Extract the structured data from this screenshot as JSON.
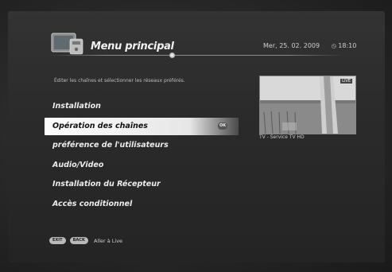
{
  "header": {
    "title": "Menu principal",
    "date": "Mer, 25. 02. 2009",
    "time": "18:10"
  },
  "description": "Éditer les chaînes et sélectionner les réseaux préférés.",
  "menu": {
    "items": [
      {
        "label": "Installation",
        "selected": false
      },
      {
        "label": "Opération des chaînes",
        "selected": true
      },
      {
        "label": "préférence de l'utilisateurs",
        "selected": false
      },
      {
        "label": "Audio/Video",
        "selected": false
      },
      {
        "label": "Installation du Récepteur",
        "selected": false
      },
      {
        "label": "Accès conditionnel",
        "selected": false
      }
    ],
    "ok_label": "OK"
  },
  "preview": {
    "badge": "LIVE",
    "channel_label": "TV - Service TV HD"
  },
  "footer": {
    "exit_label": "EXIT",
    "back_label": "BACK",
    "hint": "Aller à Live"
  },
  "icons": {
    "logo": "tv-menu-logo-icon",
    "clock": "clock-icon",
    "ok": "ok-button-icon"
  }
}
